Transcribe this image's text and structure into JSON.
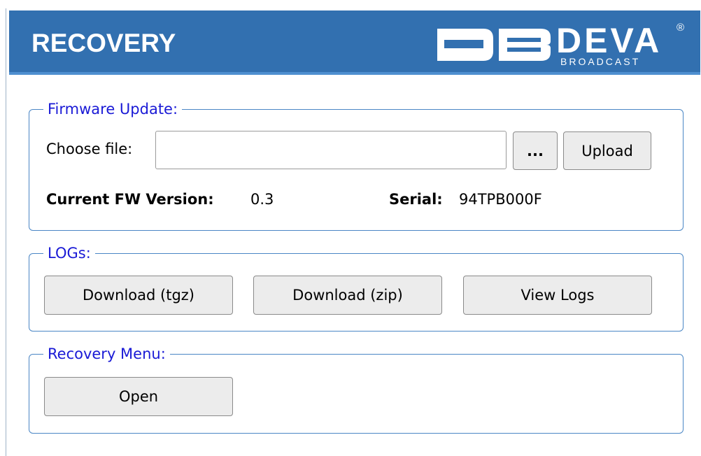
{
  "header": {
    "title": "RECOVERY",
    "logo": {
      "name": "DEVA",
      "registered": "®",
      "subtitle": "BROADCAST"
    }
  },
  "firmware": {
    "legend": "Firmware Update:",
    "choose_label": "Choose file:",
    "file_value": "",
    "browse_label": "...",
    "upload_label": "Upload",
    "fw_version_label": "Current FW Version:",
    "fw_version_value": "0.3",
    "serial_label": "Serial:",
    "serial_value": "94TPB000F"
  },
  "logs": {
    "legend": "LOGs:",
    "download_tgz": "Download (tgz)",
    "download_zip": "Download (zip)",
    "view_logs": "View Logs"
  },
  "recovery_menu": {
    "legend": "Recovery Menu:",
    "open_label": "Open"
  },
  "colors": {
    "header_bg": "#3270b0",
    "legend_text": "#1a1ad6",
    "group_border": "#4a86c5",
    "button_bg": "#ececec"
  }
}
